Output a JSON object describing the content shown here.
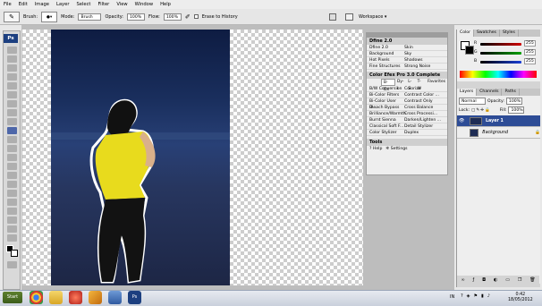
{
  "menu": [
    "File",
    "Edit",
    "Image",
    "Layer",
    "Select",
    "Filter",
    "View",
    "Window",
    "Help"
  ],
  "options_bar": {
    "brush_label": "Brush:",
    "mode_label": "Mode:",
    "mode_value": "Brush",
    "opacity_label": "Opacity:",
    "opacity_value": "100%",
    "flow_label": "Flow:",
    "flow_value": "100%",
    "erase_label": "Erase to History",
    "workspace_label": "Workspace"
  },
  "tools": {
    "logo": "Ps"
  },
  "dfine": {
    "title": "Dfine 2.0",
    "rows": [
      {
        "name": "Dfine 2.0",
        "value": "Skin"
      },
      {
        "name": "Background",
        "value": "Sky"
      },
      {
        "name": "Hot Pixels",
        "value": "Shadows"
      },
      {
        "name": "Fine Structures",
        "value": "Strong Noise"
      }
    ]
  },
  "color_efex": {
    "title": "Color Efex Pro 3.0 Complete",
    "tabs": [
      "B-Dx",
      "Dy-I",
      "L-S",
      "T-W",
      "Favorites"
    ],
    "rows": [
      {
        "name": "B/W Conversion",
        "value": "Colorize"
      },
      {
        "name": "Bi-Color Filters",
        "value": "Contrast Color ..."
      },
      {
        "name": "Bi-Color User D...",
        "value": "Contrast Only"
      },
      {
        "name": "Bleach Bypass",
        "value": "Cross Balance"
      },
      {
        "name": "Brilliance/Warmth",
        "value": "Cross Processi..."
      },
      {
        "name": "Burnt Sienna",
        "value": "Darken/Lighten ..."
      },
      {
        "name": "Classical Soft F...",
        "value": "Detail Stylizer"
      },
      {
        "name": "Color Stylizer",
        "value": "Duplex"
      }
    ],
    "tools_label": "Tools",
    "help_label": "Help",
    "settings_label": "Settings"
  },
  "color_panel": {
    "tabs": [
      "Color",
      "Swatches",
      "Styles"
    ],
    "channels": [
      {
        "letter": "R",
        "value": "255",
        "color": "#d00000"
      },
      {
        "letter": "G",
        "value": "255",
        "color": "#00a000"
      },
      {
        "letter": "B",
        "value": "255",
        "color": "#1a3fd6"
      }
    ]
  },
  "layers_panel": {
    "tabs": [
      "Layers",
      "Channels",
      "Paths"
    ],
    "blend_mode": "Normal",
    "opacity_label": "Opacity:",
    "opacity_value": "100%",
    "lock_label": "Lock:",
    "fill_label": "Fill:",
    "fill_value": "100%",
    "layers": [
      {
        "name": "Layer 1",
        "selected": true
      },
      {
        "name": "Background",
        "selected": false
      }
    ]
  },
  "taskbar": {
    "start_label": "Start",
    "lang": "IN",
    "time": "0:42",
    "date": "18/05/2012",
    "ps_label": "Ps"
  }
}
